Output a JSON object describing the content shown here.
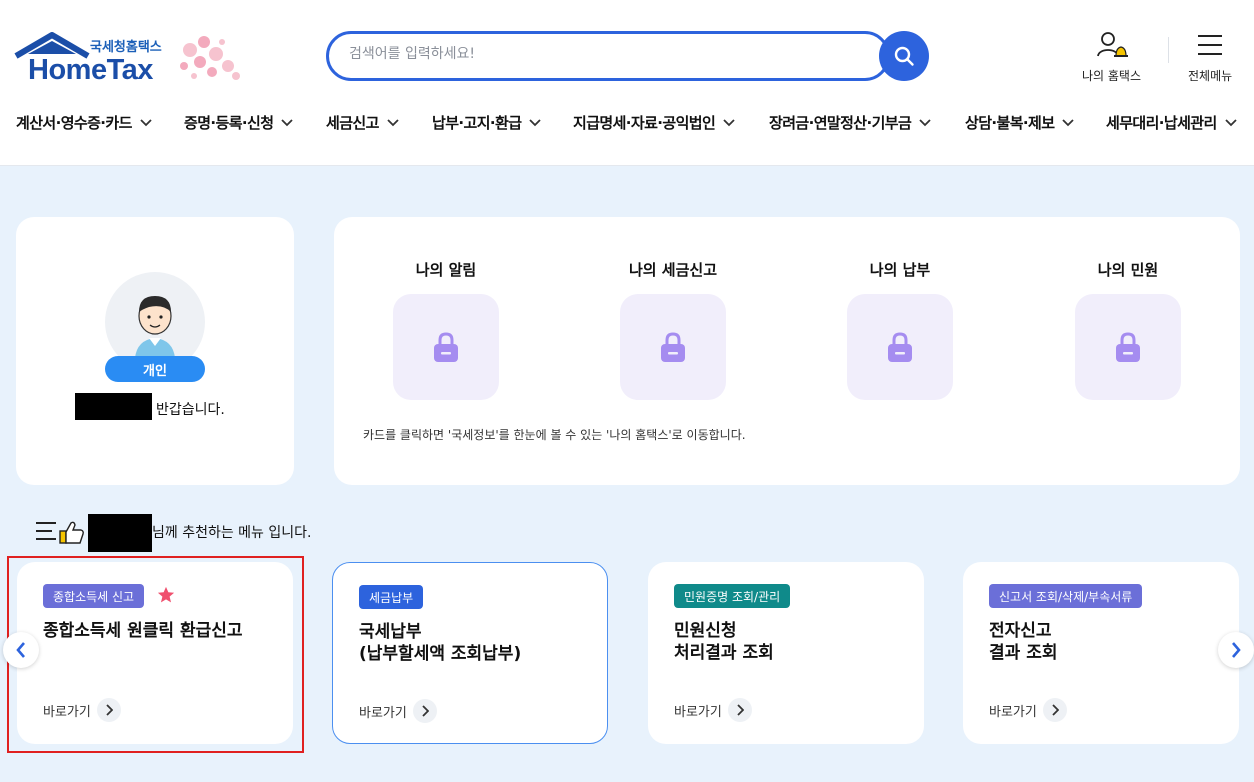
{
  "brand": {
    "sub": "국세청홈택스",
    "name": "HomeTax"
  },
  "search": {
    "placeholder": "검색어를 입력하세요!"
  },
  "utility": {
    "my_hometax": "나의 홈택스",
    "all_menu": "전체메뉴"
  },
  "gnb": [
    "계산서·영수증·카드",
    "증명·등록·신청",
    "세금신고",
    "납부·고지·환급",
    "지급명세·자료·공익법인",
    "장려금·연말정산·기부금",
    "상담·불복·제보",
    "세무대리·납세관리"
  ],
  "profile": {
    "badge": "개인",
    "greeting": "반갑습니다."
  },
  "my_cards": {
    "items": [
      "나의 알림",
      "나의 세금신고",
      "나의 납부",
      "나의 민원"
    ],
    "note": "카드를 클릭하면 '국세정보'를 한눈에 볼 수 있는 '나의 홈택스'로 이동합니다."
  },
  "recommend": {
    "title_suffix": "님께 추천하는 메뉴 입니다.",
    "goto_label": "바로가기",
    "cards": [
      {
        "tag": "종합소득세 신고",
        "tag_color": "#6b6fd8",
        "line1": "종합소득세 원클릭 환급신고",
        "line2": ""
      },
      {
        "tag": "세금납부",
        "tag_color": "#2d63dd",
        "line1": "국세납부",
        "line2": "(납부할세액 조회납부)"
      },
      {
        "tag": "민원증명 조회/관리",
        "tag_color": "#0f8a8a",
        "line1": "민원신청",
        "line2": "처리결과 조회"
      },
      {
        "tag": "신고서 조회/삭제/부속서류",
        "tag_color": "#6b6fd8",
        "line1": "전자신고",
        "line2": "결과 조회"
      }
    ]
  },
  "colors": {
    "accent": "#2d63dd",
    "background": "#e8f2fc",
    "highlight": "#e02020",
    "star": "#f0506e"
  }
}
